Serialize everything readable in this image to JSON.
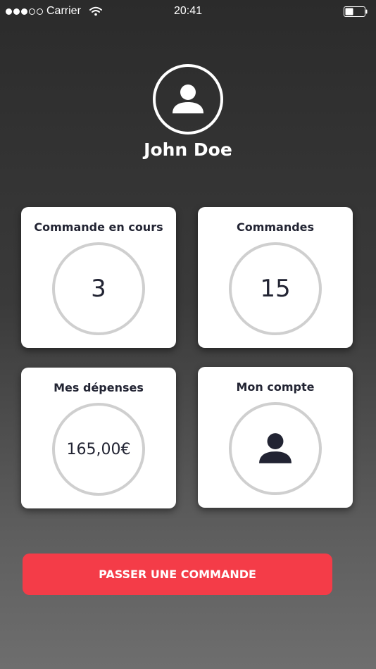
{
  "status_bar": {
    "carrier": "Carrier",
    "time": "20:41",
    "signal_icon": "signal-dots-icon",
    "signal_strength": 3,
    "signal_max": 5,
    "wifi_icon": "wifi-icon",
    "battery_icon": "battery-icon",
    "battery_level": 0.4
  },
  "profile": {
    "avatar_icon": "user-icon",
    "name": "John Doe"
  },
  "cards": {
    "current_orders": {
      "title": "Commande en cours",
      "value": "3"
    },
    "orders": {
      "title": "Commandes",
      "value": "15"
    },
    "spending": {
      "title": "Mes dépenses",
      "value": "165,00€"
    },
    "account": {
      "title": "Mon compte",
      "icon": "user-icon"
    }
  },
  "actions": {
    "order_label": "PASSER UNE COMMANDE"
  },
  "colors": {
    "accent": "#f43c48",
    "text_dark": "#222433",
    "ring": "#cfcfcf",
    "card": "#ffffff"
  }
}
